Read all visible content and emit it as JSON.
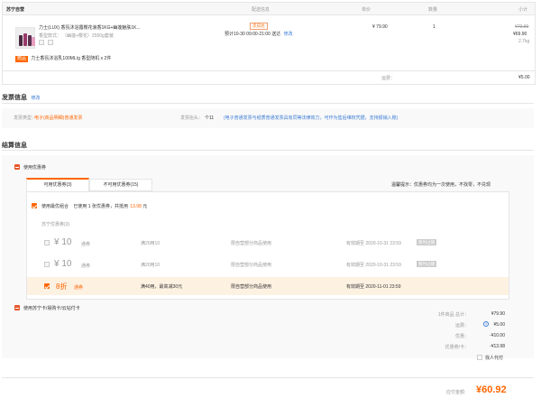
{
  "order": {
    "headers": {
      "store": "苏宁自营",
      "delivery": "配送信息",
      "price": "单价",
      "qty": "数量",
      "subtotal": "小计"
    },
    "product": {
      "name": "力士(LUX) 香氛沐浴露樱花浪香1KG+幽莲魅肤1K...",
      "spec_label": "香型款式：",
      "spec_value": "（幽莲+樱花）2550g套装",
      "gift_tag": "赠品",
      "gift_text": "力士香氛沐浴乳100ML/g 香型随机 x 2件",
      "out_badge": "次日达",
      "delivery_time": "预计10-30 09:00-21:00 送达",
      "delivery_edit": "修改",
      "price": "¥ 79.90",
      "qty": "1",
      "orig_price": "¥79.90",
      "sub_price": "¥69.90",
      "weight": "2.7kg"
    },
    "shipping_label": "运费：",
    "shipping_value": "¥5.00"
  },
  "invoice": {
    "title": "发票信息",
    "edit": "修改",
    "type_label": "发票类型：",
    "type_value": "电子(商品明细)普通发票",
    "head_label": "发票抬头：",
    "head_value": "个11",
    "note": "(电子普通发票与纸质普通发票具有同等法律效力，可作为售后维权凭据，支持报销入账)"
  },
  "settle": {
    "title": "结算信息",
    "use_coupon": "使用优惠券",
    "tabs": [
      "可用优惠券(3)",
      "不可用优惠券(15)"
    ],
    "tip": "温馨提示：优惠券均为一次使用，不找零，不兑现",
    "best_prefix": "使用最优组合",
    "best_mid": "已使用 1 张优惠券，共抵用",
    "best_amount": "13.98",
    "best_suffix": "元",
    "coupon_group": "苏宁优惠券(3)",
    "coupons": [
      {
        "value": "¥ 10",
        "type": "通券",
        "cond": "满20用10",
        "scope": "限自营部分商品使用",
        "expire": "有效期至 2020-10-31 23:59",
        "btn": "暂时过期"
      },
      {
        "value": "¥ 10",
        "type": "通券",
        "cond": "满20用10",
        "scope": "限自营部分商品使用",
        "expire": "有效期至 2020-10-31 23:59",
        "btn": "暂时过期"
      },
      {
        "value": "8折",
        "type": "通券",
        "cond": "满40用，最高减30元",
        "scope": "限自营部分商品使用",
        "expire": "有效期至 2020-11-01 23:59",
        "btn": ""
      }
    ],
    "card_label": "使用苏宁卡/易购卡/云钻付卡",
    "summary": [
      {
        "label": "1件商品 总计：",
        "value": "¥79.90"
      },
      {
        "label": "运费：",
        "value": "¥5.00"
      },
      {
        "label": "优惠：",
        "value": "-¥10.00"
      },
      {
        "label": "优惠券/卡：",
        "value": "-¥13.98"
      }
    ],
    "proxy": "找人代付"
  },
  "total": {
    "label": "应付金额:",
    "value": "¥60.92"
  }
}
